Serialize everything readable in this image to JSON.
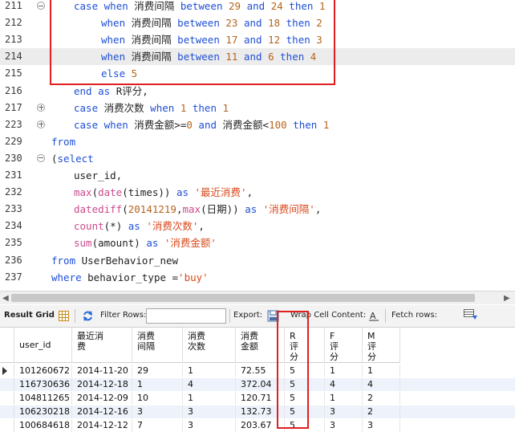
{
  "editor": {
    "lines": [
      {
        "num": "211",
        "fold": "minus",
        "indent": 28,
        "tokens": [
          [
            "k",
            "case "
          ],
          [
            "k",
            "when "
          ],
          [
            "cn",
            "消费间隔 "
          ],
          [
            "k",
            "between "
          ],
          [
            "n",
            "29 "
          ],
          [
            "k",
            "and "
          ],
          [
            "n",
            "24 "
          ],
          [
            "k",
            "then "
          ],
          [
            "n",
            "1"
          ]
        ]
      },
      {
        "num": "212",
        "fold": "",
        "indent": 62,
        "tokens": [
          [
            "k",
            "when "
          ],
          [
            "cn",
            "消费间隔 "
          ],
          [
            "k",
            "between "
          ],
          [
            "n",
            "23 "
          ],
          [
            "k",
            "and "
          ],
          [
            "n",
            "18 "
          ],
          [
            "k",
            "then "
          ],
          [
            "n",
            "2"
          ]
        ]
      },
      {
        "num": "213",
        "fold": "",
        "indent": 62,
        "tokens": [
          [
            "k",
            "when "
          ],
          [
            "cn",
            "消费间隔 "
          ],
          [
            "k",
            "between "
          ],
          [
            "n",
            "17 "
          ],
          [
            "k",
            "and "
          ],
          [
            "n",
            "12 "
          ],
          [
            "k",
            "then "
          ],
          [
            "n",
            "3"
          ]
        ]
      },
      {
        "num": "214",
        "fold": "",
        "indent": 62,
        "tokens": [
          [
            "k",
            "when "
          ],
          [
            "cn",
            "消费间隔 "
          ],
          [
            "k",
            "between "
          ],
          [
            "n",
            "11 "
          ],
          [
            "k",
            "and "
          ],
          [
            "n",
            "6 "
          ],
          [
            "k",
            "then "
          ],
          [
            "n",
            "4"
          ]
        ]
      },
      {
        "num": "215",
        "fold": "",
        "indent": 62,
        "tokens": [
          [
            "k",
            "else "
          ],
          [
            "n",
            "5"
          ]
        ]
      },
      {
        "num": "216",
        "fold": "",
        "indent": 28,
        "tokens": [
          [
            "k",
            "end "
          ],
          [
            "k",
            "as "
          ],
          [
            "cn",
            "R评分,"
          ]
        ]
      },
      {
        "num": "217",
        "fold": "plus",
        "indent": 28,
        "tokens": [
          [
            "k",
            "case "
          ],
          [
            "cn",
            "消费次数 "
          ],
          [
            "k",
            "when "
          ],
          [
            "n",
            "1 "
          ],
          [
            "k",
            "then "
          ],
          [
            "n",
            "1"
          ]
        ]
      },
      {
        "num": "223",
        "fold": "plus",
        "indent": 28,
        "tokens": [
          [
            "k",
            "case "
          ],
          [
            "k",
            "when "
          ],
          [
            "cn",
            "消费金额"
          ],
          [
            "p",
            ">="
          ],
          [
            "n",
            "0 "
          ],
          [
            "k",
            "and "
          ],
          [
            "cn",
            "消费金额"
          ],
          [
            "p",
            "<"
          ],
          [
            "n",
            "100 "
          ],
          [
            "k",
            "then "
          ],
          [
            "n",
            "1"
          ]
        ]
      },
      {
        "num": "229",
        "fold": "",
        "indent": 0,
        "tokens": [
          [
            "k",
            "from"
          ]
        ]
      },
      {
        "num": "230",
        "fold": "minus",
        "indent": 0,
        "tokens": [
          [
            "p",
            "("
          ],
          [
            "k",
            "select"
          ]
        ]
      },
      {
        "num": "231",
        "fold": "",
        "indent": 28,
        "tokens": [
          [
            "p",
            "user_id,"
          ]
        ]
      },
      {
        "num": "232",
        "fold": "",
        "indent": 28,
        "tokens": [
          [
            "f",
            "max"
          ],
          [
            "p",
            "("
          ],
          [
            "f",
            "date"
          ],
          [
            "p",
            "(times)) "
          ],
          [
            "k",
            "as "
          ],
          [
            "s",
            "'最近消费'"
          ],
          [
            "p",
            ","
          ]
        ]
      },
      {
        "num": "233",
        "fold": "",
        "indent": 28,
        "tokens": [
          [
            "f",
            "datediff"
          ],
          [
            "p",
            "("
          ],
          [
            "n",
            "20141219"
          ],
          [
            "p",
            ","
          ],
          [
            "f",
            "max"
          ],
          [
            "p",
            "(日期)) "
          ],
          [
            "k",
            "as "
          ],
          [
            "s",
            "'消费间隔'"
          ],
          [
            "p",
            ","
          ]
        ]
      },
      {
        "num": "234",
        "fold": "",
        "indent": 28,
        "tokens": [
          [
            "f",
            "count"
          ],
          [
            "p",
            "(*) "
          ],
          [
            "k",
            "as "
          ],
          [
            "s",
            "'消费次数'"
          ],
          [
            "p",
            ","
          ]
        ]
      },
      {
        "num": "235",
        "fold": "",
        "indent": 28,
        "tokens": [
          [
            "f",
            "sum"
          ],
          [
            "p",
            "(amount) "
          ],
          [
            "k",
            "as "
          ],
          [
            "s",
            "'消费金额'"
          ]
        ]
      },
      {
        "num": "236",
        "fold": "",
        "indent": 0,
        "tokens": [
          [
            "k",
            "from "
          ],
          [
            "p",
            "UserBehavior_new"
          ]
        ]
      },
      {
        "num": "237",
        "fold": "",
        "indent": 0,
        "tokens": [
          [
            "k",
            "where "
          ],
          [
            "p",
            "behavior_type ="
          ],
          [
            "s",
            "'buy'"
          ]
        ]
      }
    ]
  },
  "toolbar": {
    "result_grid": "Result Grid",
    "filter_rows": "Filter Rows:",
    "export": "Export:",
    "wrap": "Wrap Cell Content:",
    "fetch": "Fetch rows:"
  },
  "grid": {
    "columns": [
      "user_id",
      "最近消\n费",
      "消费\n间隔",
      "消费\n次数",
      "消费\n金额",
      "R\n评\n分",
      "F\n评\n分",
      "M\n评\n分"
    ],
    "rows": [
      [
        "101260672",
        "2014-11-20",
        "29",
        "1",
        "72.55",
        "5",
        "1",
        "1"
      ],
      [
        "116730636",
        "2014-12-18",
        "1",
        "4",
        "372.04",
        "5",
        "4",
        "4"
      ],
      [
        "104811265",
        "2014-12-09",
        "10",
        "1",
        "120.71",
        "5",
        "1",
        "2"
      ],
      [
        "106230218",
        "2014-12-16",
        "3",
        "3",
        "132.73",
        "5",
        "3",
        "2"
      ],
      [
        "100684618",
        "2014-12-12",
        "7",
        "3",
        "203.67",
        "5",
        "3",
        "3"
      ]
    ]
  },
  "colors": {
    "keyword": "#1f4fd6",
    "number": "#b5651d",
    "string": "#d8491b",
    "highlight_box": "#e02020"
  }
}
